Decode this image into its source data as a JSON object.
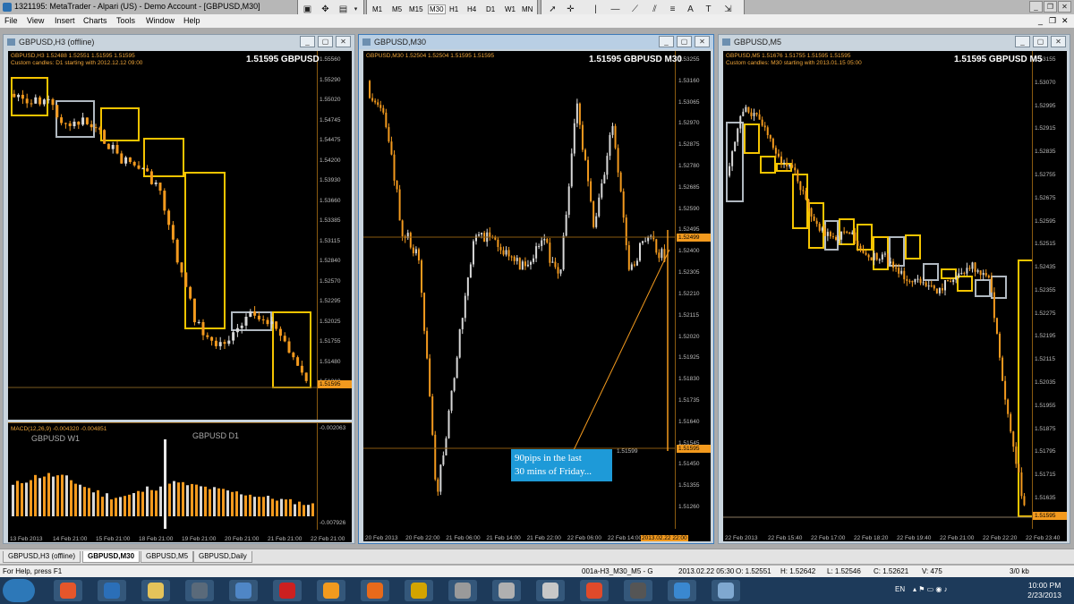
{
  "app": {
    "title": "1321195: MetaTrader - Alpari (US) - Demo Account - [GBPUSD,M30]"
  },
  "timeframes": [
    "M1",
    "M5",
    "M15",
    "M30",
    "H1",
    "H4",
    "D1",
    "W1",
    "MN"
  ],
  "active_timeframe": "M30",
  "menu": [
    "File",
    "View",
    "Insert",
    "Charts",
    "Tools",
    "Window",
    "Help"
  ],
  "windows": {
    "left": {
      "title": "GBPUSD,H3 (offline)",
      "info1": "GBPUSD,H3  1.52488 1.52551 1.51595 1.51595",
      "info2": "Custom candles: D1 starting with 2012.12.12 09:00",
      "big": "1.51595 GBPUSD",
      "prices": [
        "1.55560",
        "1.55290",
        "1.55020",
        "1.54745",
        "1.54475",
        "1.54200",
        "1.53930",
        "1.53660",
        "1.53385",
        "1.53115",
        "1.52840",
        "1.52570",
        "1.52295",
        "1.52025",
        "1.51755",
        "1.51480",
        "1.51210"
      ],
      "current": "1.51595",
      "times": [
        "13 Feb 2013",
        "14 Feb 21:00",
        "15 Feb 21:00",
        "18 Feb 21:00",
        "19 Feb 21:00",
        "20 Feb 21:00",
        "21 Feb 21:00",
        "22 Feb 21:00"
      ],
      "macd_label": "MACD(12,26,9) -0.004320 -0.004851",
      "macd_w1": "GBPUSD W1",
      "macd_d1": "GBPUSD D1",
      "macd_top": "-0.002063",
      "macd_bottom": "-0.007926"
    },
    "middle": {
      "title": "GBPUSD,M30",
      "info1": "GBPUSD,M30  1.52504 1.52504 1.51595 1.51595",
      "big": "1.51595 GBPUSD M30",
      "prices": [
        "1.53255",
        "1.53160",
        "1.53065",
        "1.52970",
        "1.52875",
        "1.52780",
        "1.52685",
        "1.52590",
        "1.52495",
        "1.52400",
        "1.52305",
        "1.52210",
        "1.52115",
        "1.52020",
        "1.51925",
        "1.51830",
        "1.51735",
        "1.51640",
        "1.51545",
        "1.51450",
        "1.51355",
        "1.51260"
      ],
      "current_top": "1.52499",
      "current_bottom": "1.51595",
      "line_label": "1.51599",
      "annotation": [
        "90pips in the last",
        "30 mins of Friday..."
      ],
      "times": [
        "20 Feb 2013",
        "20 Feb 22:00",
        "21 Feb 06:00",
        "21 Feb 14:00",
        "21 Feb 22:00",
        "22 Feb 06:00",
        "22 Feb 14:00"
      ],
      "time_highlight": "2013.02.22 22:00"
    },
    "right": {
      "title": "GBPUSD,M5",
      "info1": "GBPUSD,M5  1.51676 1.51755 1.51595 1.51595",
      "info2": "Custom candles: M30 starting with 2013.01.15 05:00",
      "big": "1.51595 GBPUSD M5",
      "prices": [
        "1.53155",
        "1.53070",
        "1.52995",
        "1.52915",
        "1.52835",
        "1.52755",
        "1.52675",
        "1.52595",
        "1.52515",
        "1.52435",
        "1.52355",
        "1.52275",
        "1.52195",
        "1.52115",
        "1.52035",
        "1.51955",
        "1.51875",
        "1.51795",
        "1.51715",
        "1.51635"
      ],
      "current": "1.51595",
      "times": [
        "22 Feb 2013",
        "22 Feb 15:40",
        "22 Feb 17:00",
        "22 Feb 18:20",
        "22 Feb 19:40",
        "22 Feb 21:00",
        "22 Feb 22:20",
        "22 Feb 23:40"
      ]
    }
  },
  "tabs": [
    "GBPUSD,H3 (offline)",
    "GBPUSD,M30",
    "GBPUSD,M5",
    "GBPUSD,Daily"
  ],
  "active_tab": "GBPUSD,M30",
  "status": {
    "help": "For Help, press F1",
    "profile": "001a-H3_M30_M5 - G",
    "datetime": "2013.02.22 05:30",
    "open": "O: 1.52551",
    "high": "H: 1.52642",
    "low": "L: 1.52546",
    "close": "C: 1.52621",
    "volume": "V: 475",
    "traffic": "3/0 kb"
  },
  "taskbar": {
    "lang": "EN",
    "time": "10:00 PM",
    "date": "2/23/2013",
    "apps": [
      "firefox",
      "metatrader",
      "folder",
      "calculator",
      "app",
      "red-app",
      "orange-app",
      "media-player",
      "gold-app",
      "alpari",
      "alpari",
      "alpari",
      "k-app",
      "chrome-app",
      "ship-app",
      "paint-app"
    ]
  },
  "colors": {
    "chart_bg": "#000000",
    "bull_candle": "#d8d8d8",
    "bear_candle": "#f39a1e",
    "box_yellow": "#f5c400",
    "box_white": "#b0b8c0",
    "annotation_bg": "#1e9ad8"
  }
}
